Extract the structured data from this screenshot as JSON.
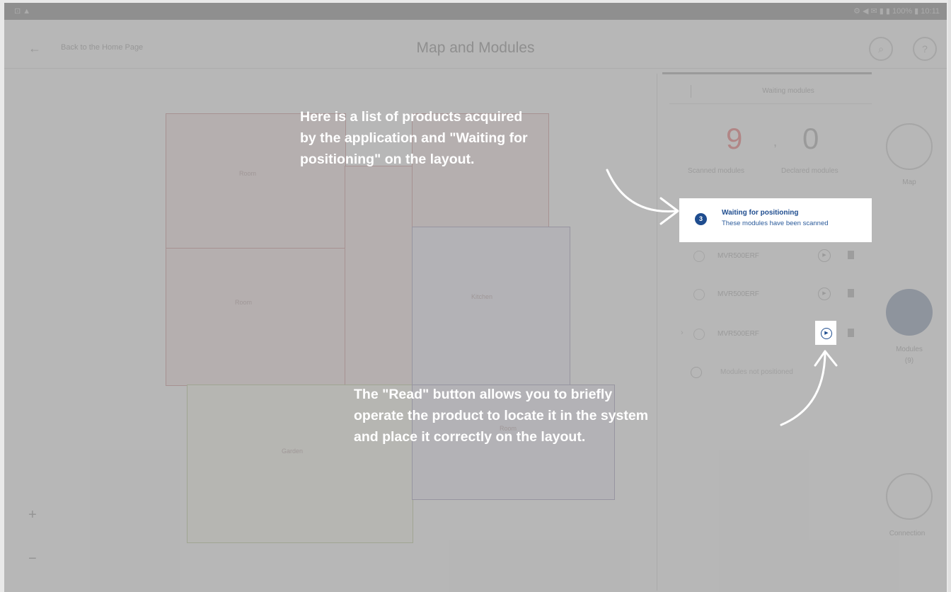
{
  "status_bar": {
    "left": "⊡ ▲",
    "right": "⚙ ◀ ✉ ▮ ▮ 100% ▮ 10:11"
  },
  "header": {
    "back_label": "Back to the Home Page",
    "title": "Map and Modules"
  },
  "map": {
    "block_labels": [
      "Room",
      "Room",
      "Kitchen",
      "Garden",
      "Room"
    ],
    "zoom_in": "+",
    "zoom_out": "−"
  },
  "panel": {
    "tab_title": "Waiting modules",
    "scanned_count": "9",
    "declared_count": "0",
    "separator": ",",
    "scanned_label": "Scanned modules",
    "declared_label": "Declared modules",
    "waiting": {
      "badge": "3",
      "title": "Waiting for positioning",
      "subtitle": "These modules have been scanned"
    },
    "modules": [
      {
        "name": "MVR500ERF"
      },
      {
        "name": "MVR500ERF"
      },
      {
        "name": "MVR500ERF"
      }
    ],
    "other_row": "Modules not positioned"
  },
  "side_nav": {
    "map_label": "Map",
    "modules_label": "Modules",
    "modules_count": "(9)",
    "connection_label": "Connection"
  },
  "annotations": {
    "top": [
      "Here is a list of products acquired",
      "by the application and \"Waiting for",
      "positioning\" on the layout."
    ],
    "bottom": [
      "The \"Read\" button allows you to briefly",
      "operate the product to locate it in the system",
      "and place it correctly on the layout."
    ]
  },
  "colors": {
    "accent": "#1f4d8f",
    "count_red": "#e89a9a",
    "overlay": "rgba(110,110,110,0.45)"
  }
}
